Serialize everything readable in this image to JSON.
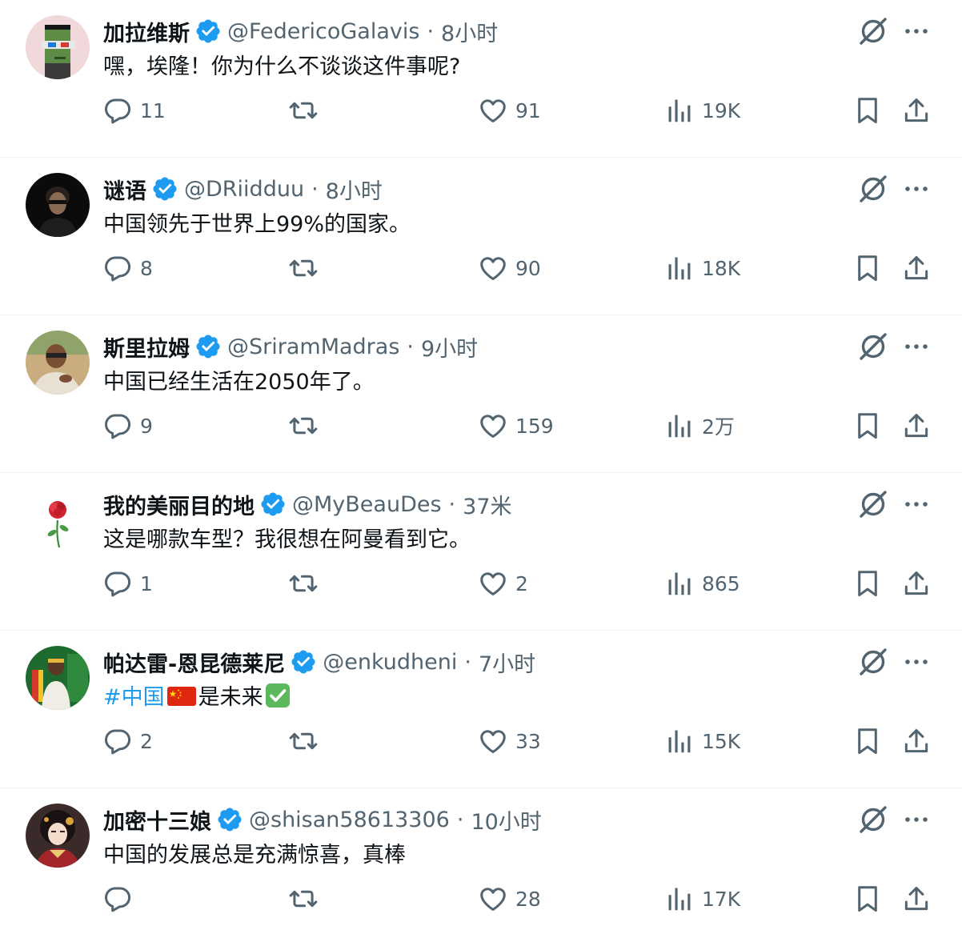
{
  "colors": {
    "accent": "#1d9bf0",
    "secondary_text": "#536471",
    "primary_text": "#0f1419",
    "divider": "#eff3f4"
  },
  "icons": [
    "verified-badge-icon",
    "grok-icon",
    "more-icon",
    "reply-icon",
    "retweet-icon",
    "like-icon",
    "views-icon",
    "bookmark-icon",
    "share-icon",
    "china-flag-icon",
    "check-mark-icon"
  ],
  "tweets": [
    {
      "name": "加拉维斯",
      "handle": "@FedericoGalavis",
      "separator": "·",
      "time": "8小时",
      "text": "嘿，埃隆！你为什么不谈谈这件事呢?",
      "replies": "11",
      "retweets": "",
      "likes": "91",
      "views": "19K"
    },
    {
      "name": "谜语",
      "handle": "@DRiidduu",
      "separator": "·",
      "time": "8小时",
      "text": "中国领先于世界上99%的国家。",
      "replies": "8",
      "retweets": "",
      "likes": "90",
      "views": "18K"
    },
    {
      "name": "斯里拉姆",
      "handle": "@SriramMadras",
      "separator": "·",
      "time": "9小时",
      "text": "中国已经生活在2050年了。",
      "replies": "9",
      "retweets": "",
      "likes": "159",
      "views": "2万"
    },
    {
      "name": "我的美丽目的地",
      "handle": "@MyBeauDes",
      "separator": "·",
      "time": "37米",
      "text": "这是哪款车型？我很想在阿曼看到它。",
      "replies": "1",
      "retweets": "",
      "likes": "2",
      "views": "865"
    },
    {
      "name": "帕达雷-恩昆德莱尼",
      "handle": "@enkudheni",
      "separator": "·",
      "time": "7小时",
      "text_hashtag": "#中国",
      "text_rest": "是未来",
      "replies": "2",
      "retweets": "",
      "likes": "33",
      "views": "15K"
    },
    {
      "name": "加密十三娘",
      "handle": "@shisan58613306",
      "separator": "·",
      "time": "10小时",
      "text": "中国的发展总是充满惊喜，真棒",
      "replies": "",
      "retweets": "",
      "likes": "28",
      "views": "17K"
    }
  ]
}
